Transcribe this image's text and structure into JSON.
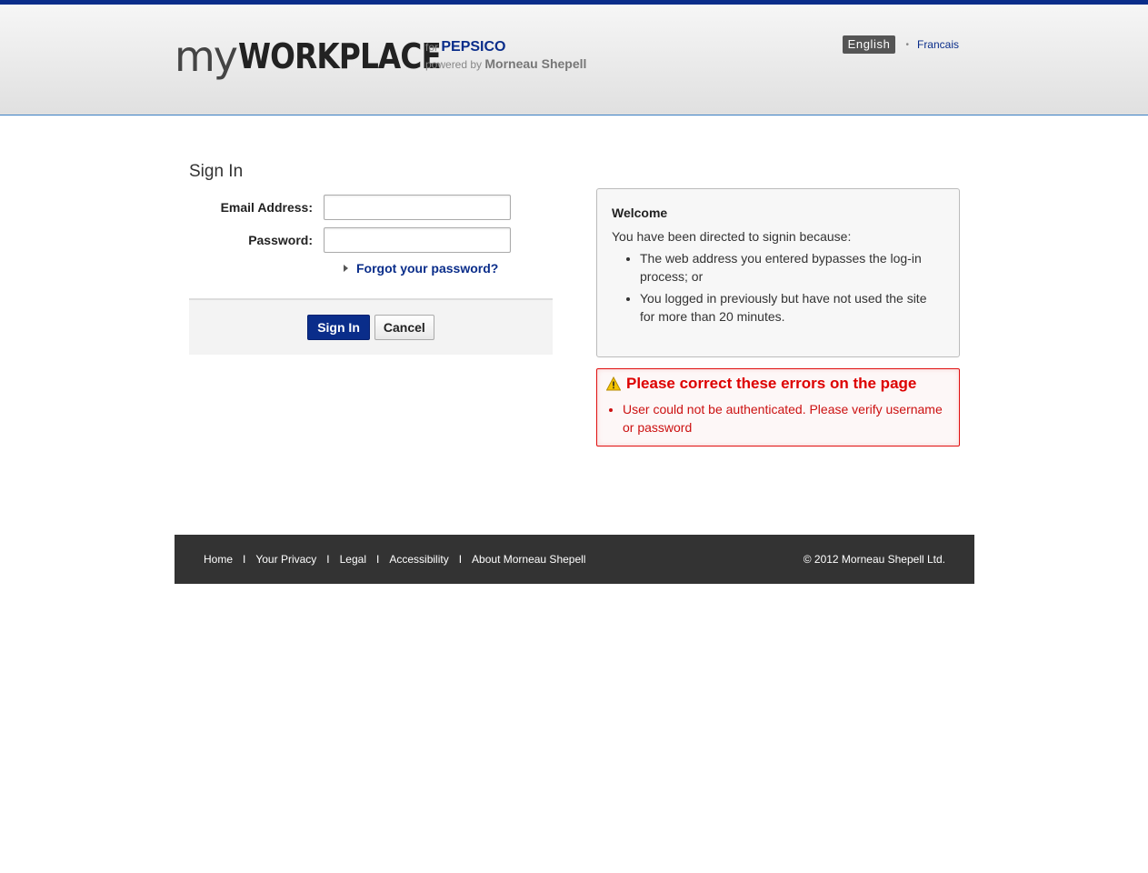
{
  "header": {
    "logo_prefix": "my",
    "logo_main": "WORKPLACE",
    "for_label": "for",
    "client": "PEPSICO",
    "powered_label": "powered by",
    "provider": "Morneau Shepell",
    "lang_active": "English",
    "lang_other": "Francais"
  },
  "signin": {
    "title": "Sign In",
    "email_label": "Email Address:",
    "email_value": "",
    "password_label": "Password:",
    "password_value": "",
    "forgot_link": "Forgot your password?",
    "signin_button": "Sign In",
    "cancel_button": "Cancel"
  },
  "welcome": {
    "title": "Welcome",
    "intro": "You have been directed to signin because:",
    "reasons": [
      "The web address you entered bypasses the log-in process; or",
      "You logged in previously but have not used the site for more than 20 minutes."
    ]
  },
  "errors": {
    "title": "Please correct these errors on the page",
    "items": [
      "User could not be authenticated. Please verify username or password"
    ]
  },
  "footer": {
    "links": [
      "Home",
      "Your Privacy",
      "Legal",
      "Accessibility",
      "About Morneau Shepell"
    ],
    "divider": "I",
    "copyright": "© 2012 Morneau Shepell Ltd."
  },
  "colors": {
    "brand": "#0a2d8a",
    "error": "#dd0000",
    "footer": "#333333"
  },
  "icons": {
    "warning": "warning-triangle-icon",
    "forgot": "triangle-right-icon"
  }
}
